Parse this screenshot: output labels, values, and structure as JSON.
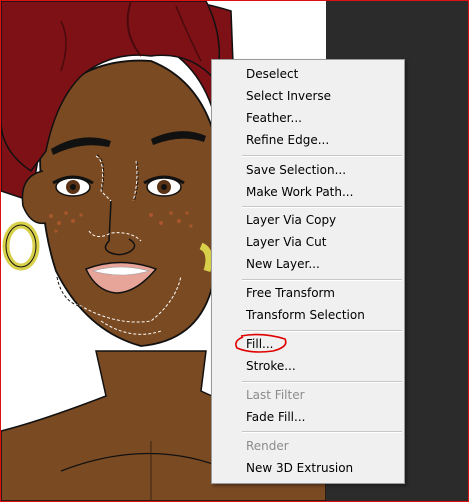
{
  "context_menu": {
    "items": [
      {
        "label": "Deselect",
        "enabled": true
      },
      {
        "label": "Select Inverse",
        "enabled": true
      },
      {
        "label": "Feather...",
        "enabled": true
      },
      {
        "label": "Refine Edge...",
        "enabled": true
      },
      {
        "label": "Save Selection...",
        "enabled": true
      },
      {
        "label": "Make Work Path...",
        "enabled": true
      },
      {
        "label": "Layer Via Copy",
        "enabled": true
      },
      {
        "label": "Layer Via Cut",
        "enabled": true
      },
      {
        "label": "New Layer...",
        "enabled": true
      },
      {
        "label": "Free Transform",
        "enabled": true
      },
      {
        "label": "Transform Selection",
        "enabled": true
      },
      {
        "label": "Fill...",
        "enabled": true,
        "annotated": true
      },
      {
        "label": "Stroke...",
        "enabled": true
      },
      {
        "label": "Last Filter",
        "enabled": false
      },
      {
        "label": "Fade Fill...",
        "enabled": true
      },
      {
        "label": "Render",
        "enabled": false
      },
      {
        "label": "New 3D Extrusion",
        "enabled": true
      }
    ]
  },
  "colors": {
    "hair": "#7e1116",
    "skin": "#7a4a22",
    "earring": "#d9d04a",
    "menu_background": "#f0f0f0",
    "annotation": "#e00000",
    "frame_border": "#dd1111",
    "dark_panel": "#2b2b2b"
  }
}
